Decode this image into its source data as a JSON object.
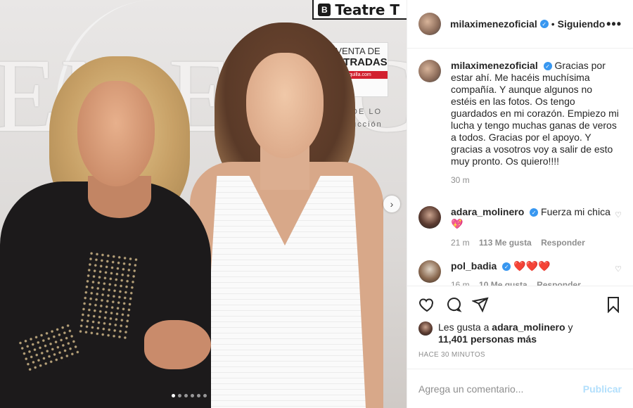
{
  "photo": {
    "banner": {
      "mark": "B",
      "word": "Teatre T"
    },
    "backdrop_text": "EN ERIC",
    "venta": {
      "line1": "VENTA DE",
      "line2": "ENTRADAS",
      "sub": "taquilla.com"
    },
    "small_sign": [
      "DE LO",
      "ucción"
    ],
    "carousel_dots": 6,
    "active_dot": 0
  },
  "header": {
    "username": "milaximenezoficial",
    "separator": "•",
    "follow_state": "Siguiendo",
    "more": "•••"
  },
  "caption": {
    "username": "milaximenezoficial",
    "text": "Gracias por estar ahí. Me hacéis muchísima compañía. Y aunque algunos no estéis en las fotos. Os tengo guardados en mi corazón. Empiezo mi lucha y tengo muchas ganas de veros a todos. Gracias por el apoyo. Y gracias a vosotros voy a salir de esto muy pronto. Os quiero!!!!",
    "time": "30 m"
  },
  "comments": [
    {
      "username": "adara_molinero",
      "text": "Fuerza mi chica 💖",
      "time": "21 m",
      "likes": "113 Me gusta",
      "reply": "Responder"
    },
    {
      "username": "pol_badia",
      "text": "❤️❤️❤️",
      "time": "16 m",
      "likes": "10 Me gusta",
      "reply": "Responder"
    }
  ],
  "likes": {
    "prefix": "Les gusta a",
    "user": "adara_molinero",
    "middle": "y",
    "count": "11,401 personas más"
  },
  "timestamp": "HACE 30 MINUTOS",
  "add_comment": {
    "placeholder": "Agrega un comentario...",
    "publish": "Publicar"
  },
  "icons": [
    "heart-icon",
    "comment-icon",
    "share-icon",
    "bookmark-icon"
  ],
  "colors": {
    "verified": "#3897f0",
    "publish": "#b2dffc",
    "meta": "#8e8e8e"
  }
}
